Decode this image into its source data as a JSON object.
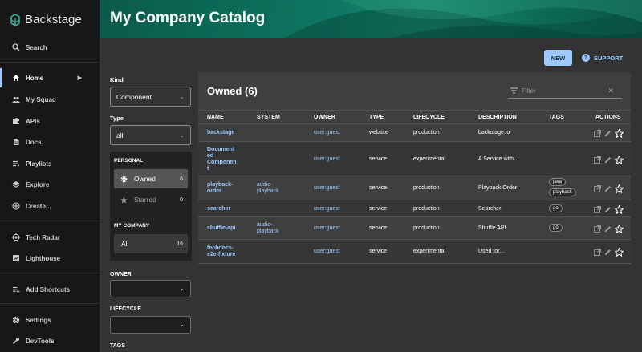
{
  "app": {
    "logo_text": "Backstage"
  },
  "sidebar": {
    "items": [
      {
        "label": "Search",
        "icon": "search-icon"
      },
      {
        "label": "Home",
        "icon": "home-icon",
        "active": true
      },
      {
        "label": "My Squad",
        "icon": "group-icon"
      },
      {
        "label": "APIs",
        "icon": "puzzle-icon"
      },
      {
        "label": "Docs",
        "icon": "docs-icon"
      },
      {
        "label": "Playlists",
        "icon": "playlist-icon"
      },
      {
        "label": "Explore",
        "icon": "layers-icon"
      },
      {
        "label": "Create...",
        "icon": "add-circle-icon"
      },
      {
        "label": "Tech Radar",
        "icon": "radar-icon"
      },
      {
        "label": "Lighthouse",
        "icon": "lighthouse-icon"
      },
      {
        "label": "Add Shortcuts",
        "icon": "playlist-add-icon"
      },
      {
        "label": "Settings",
        "icon": "gear-icon"
      },
      {
        "label": "DevTools",
        "icon": "build-icon"
      }
    ]
  },
  "header": {
    "title": "My Company Catalog"
  },
  "toolbar": {
    "new_label": "NEW",
    "support_label": "SUPPORT"
  },
  "filters": {
    "kind_label": "Kind",
    "kind_value": "Component",
    "type_label": "Type",
    "type_value": "all",
    "personal_label": "PERSONAL",
    "owned_label": "Owned",
    "owned_count": "6",
    "starred_label": "Starred",
    "starred_count": "0",
    "company_label": "MY COMPANY",
    "all_label": "All",
    "all_count": "16",
    "owner_label": "OWNER",
    "lifecycle_label": "LIFECYCLE",
    "tags_label": "TAGS"
  },
  "table": {
    "title": "Owned (6)",
    "filter_placeholder": "Filter",
    "columns": [
      "NAME",
      "SYSTEM",
      "OWNER",
      "TYPE",
      "LIFECYCLE",
      "DESCRIPTION",
      "TAGS",
      "ACTIONS"
    ],
    "rows": [
      {
        "name": "backstage",
        "system": "",
        "owner": "user:guest",
        "type": "website",
        "lifecycle": "production",
        "description": "backstage.io",
        "tags": []
      },
      {
        "name": "Document\ned\nComponen\nt",
        "system": "",
        "owner": "user:guest",
        "type": "service",
        "lifecycle": "experimental",
        "description": "A Service with…",
        "tags": []
      },
      {
        "name": "playback-\norder",
        "system": "audio-\nplayback",
        "owner": "user:guest",
        "type": "service",
        "lifecycle": "production",
        "description": "Playback Order",
        "tags": [
          "java",
          "playback"
        ]
      },
      {
        "name": "searcher",
        "system": "",
        "owner": "user:guest",
        "type": "service",
        "lifecycle": "production",
        "description": "Searcher",
        "tags": [
          "go"
        ]
      },
      {
        "name": "shuffle-api",
        "system": "audio-\nplayback",
        "owner": "user:guest",
        "type": "service",
        "lifecycle": "production",
        "description": "Shuffle API",
        "tags": [
          "go"
        ]
      },
      {
        "name": "techdocs-\ne2e-fixture",
        "system": "",
        "owner": "user:guest",
        "type": "service",
        "lifecycle": "experimental",
        "description": "Used for…",
        "tags": []
      }
    ]
  },
  "colors": {
    "accent": "#9cc9ff",
    "header_green": "#0e7862"
  }
}
